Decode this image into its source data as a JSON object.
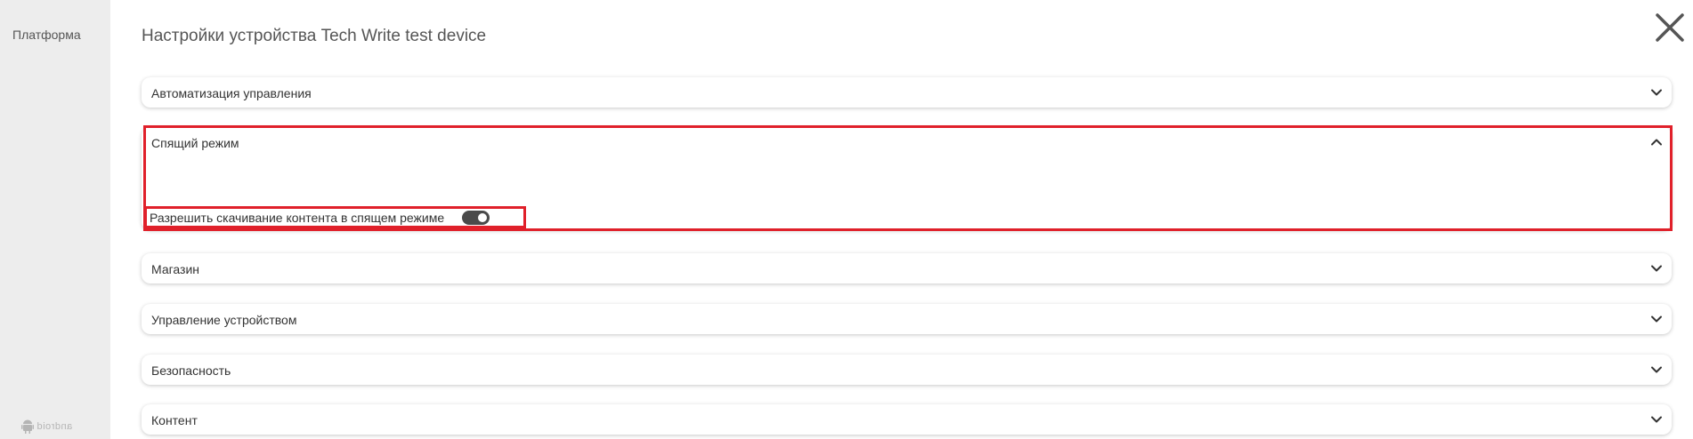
{
  "sidebar": {
    "label": "Платформа",
    "footer_logo": "android"
  },
  "header": {
    "title": "Настройки устройства Tech Write test device",
    "close_icon": "close-icon"
  },
  "sections": [
    {
      "label": "Автоматизация управления",
      "expanded": false
    },
    {
      "label": "Спящий режим",
      "expanded": true
    },
    {
      "label": "Магазин",
      "expanded": false
    },
    {
      "label": "Управление устройством",
      "expanded": false
    },
    {
      "label": "Безопасность",
      "expanded": false
    },
    {
      "label": "Контент",
      "expanded": false
    }
  ],
  "sleep_mode": {
    "toggle_label": "Разрешить скачивание контента в спящем режиме",
    "toggle_on": true
  },
  "colors": {
    "highlight": "#e0202a",
    "toggle_on": "#4a4a4a",
    "sidebar_bg": "#ededed"
  }
}
